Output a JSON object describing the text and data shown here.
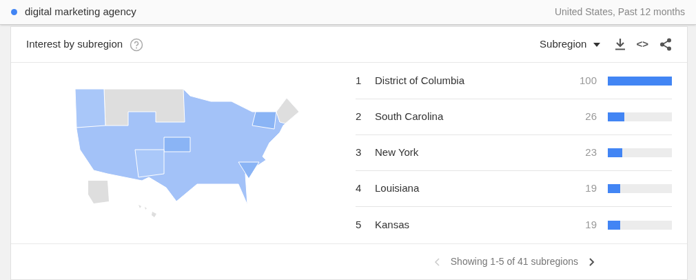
{
  "search_term": {
    "label": "digital marketing agency",
    "color": "#4285f4"
  },
  "scope": "United States, Past 12 months",
  "card": {
    "title": "Interest by subregion",
    "dropdown": "Subregion",
    "embed_glyph": "<>"
  },
  "rows": [
    {
      "rank": "1",
      "name": "District of Columbia",
      "value": "100",
      "level": 1.0
    },
    {
      "rank": "2",
      "name": "South Carolina",
      "value": "26",
      "level": 0.26
    },
    {
      "rank": "3",
      "name": "New York",
      "value": "23",
      "level": 0.23
    },
    {
      "rank": "4",
      "name": "Louisiana",
      "value": "19",
      "level": 0.19
    },
    {
      "rank": "5",
      "name": "Kansas",
      "value": "19",
      "level": 0.19
    }
  ],
  "pager": {
    "text": "Showing 1-5 of 41 subregions",
    "prev_disabled": true,
    "next_disabled": false
  }
}
